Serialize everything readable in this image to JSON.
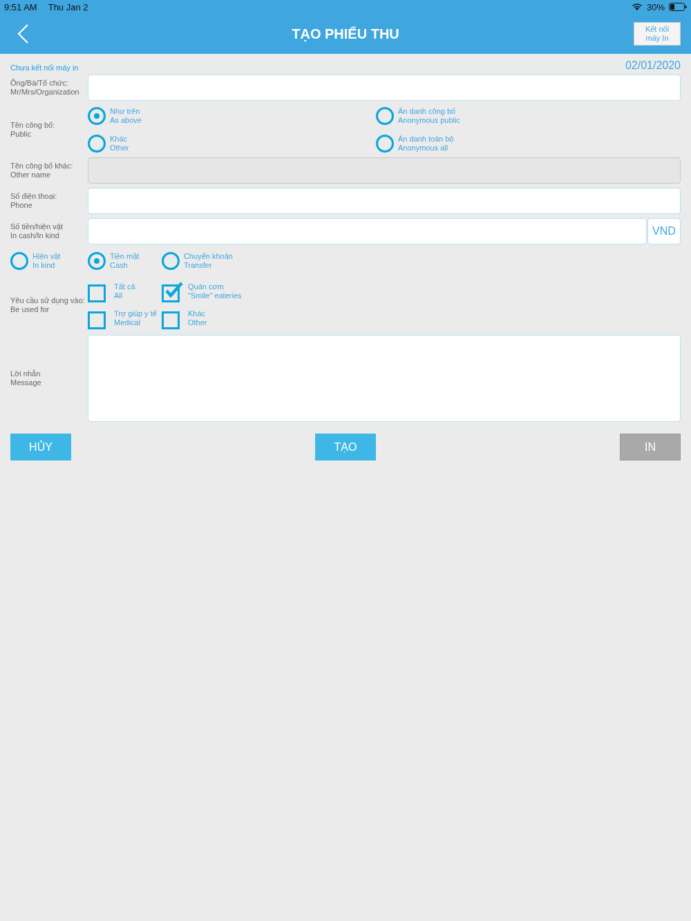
{
  "status_bar": {
    "time": "9:51 AM",
    "date": "Thu Jan 2",
    "battery": "30%"
  },
  "header": {
    "title": "TẠO PHIẾU THU",
    "printer_button": "Kết nối\nmáy In"
  },
  "printer_status": "Chưa kết nối máy in",
  "date": "02/01/2020",
  "name_field": {
    "label": "Ông/Bà/Tổ chức:\nMr/Mrs/Organization",
    "disabled": false
  },
  "public_name": {
    "label": "Tên công bố:\nPublic",
    "options": [
      {
        "label": "Như trên\nAs above",
        "selected": true
      },
      {
        "label": "Ẩn danh công bố\nAnonymous public",
        "selected": false
      },
      {
        "label": "Khác\nOther",
        "selected": false
      },
      {
        "label": "Ẩn danh toàn bộ\nAnonymous all",
        "selected": false
      }
    ]
  },
  "other_name_field": {
    "label": "Tên công bố khác:\nOther name",
    "disabled": true
  },
  "phone_field": {
    "label": "Số điện thoại:\nPhone",
    "disabled": false
  },
  "amount_field": {
    "label": "Số tiền/hiện vật\nIn cash/In kind",
    "currency": "VND"
  },
  "payment_type": [
    {
      "label": "Hiện vật\nIn kind",
      "selected": false
    },
    {
      "label": "Tiền mặt\nCash",
      "selected": true
    },
    {
      "label": "Chuyển khoản\nTransfer",
      "selected": false
    }
  ],
  "usage": {
    "label": "Yêu cầu sử dụng vào:\nBe used for",
    "options": [
      {
        "label": "Tất cả\nAll",
        "checked": false
      },
      {
        "label": "Quán cơm\n\"Smile\" eateries",
        "checked": true
      },
      {
        "label": "Trợ giúp y tế\nMedical",
        "checked": false
      },
      {
        "label": "Khác\nOther",
        "checked": false
      }
    ]
  },
  "message_field": {
    "label": "Lời nhắn\nMessage"
  },
  "buttons": [
    {
      "label": "HỦY",
      "disabled": false
    },
    {
      "label": "TẠO",
      "disabled": false
    },
    {
      "label": "IN",
      "disabled": true
    }
  ]
}
